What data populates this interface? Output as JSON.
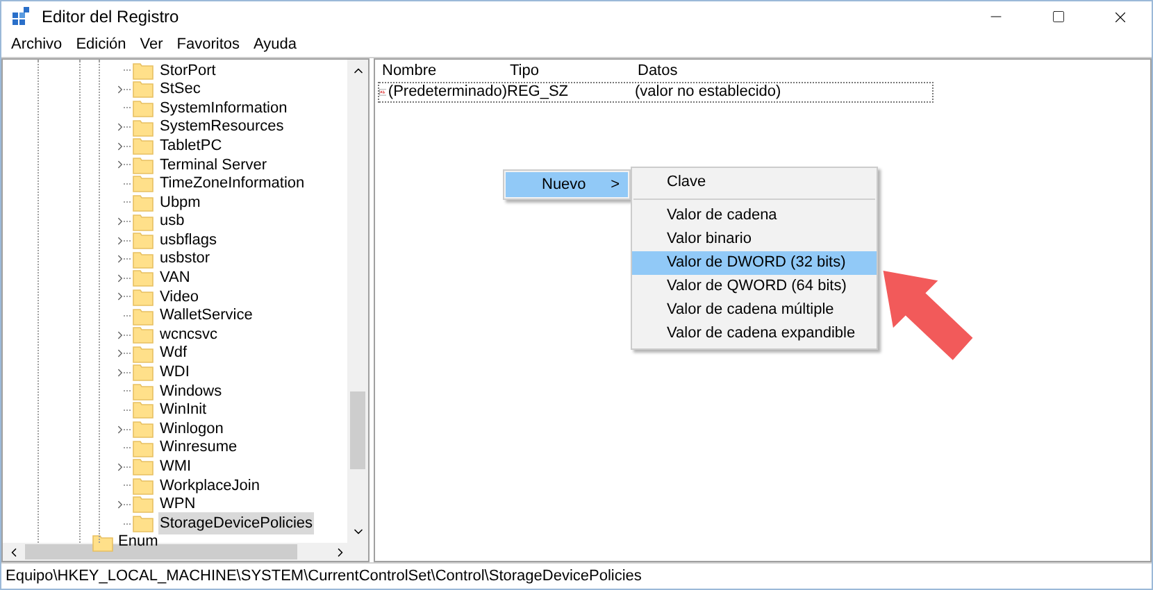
{
  "window": {
    "title": "Editor del Registro"
  },
  "menu_bar": [
    "Archivo",
    "Edición",
    "Ver",
    "Favoritos",
    "Ayuda"
  ],
  "tree": {
    "items": [
      {
        "label": "StorPort",
        "expandable": false,
        "selected": false
      },
      {
        "label": "StSec",
        "expandable": true,
        "selected": false
      },
      {
        "label": "SystemInformation",
        "expandable": false,
        "selected": false
      },
      {
        "label": "SystemResources",
        "expandable": true,
        "selected": false
      },
      {
        "label": "TabletPC",
        "expandable": true,
        "selected": false
      },
      {
        "label": "Terminal Server",
        "expandable": true,
        "selected": false
      },
      {
        "label": "TimeZoneInformation",
        "expandable": false,
        "selected": false
      },
      {
        "label": "Ubpm",
        "expandable": false,
        "selected": false
      },
      {
        "label": "usb",
        "expandable": true,
        "selected": false
      },
      {
        "label": "usbflags",
        "expandable": true,
        "selected": false
      },
      {
        "label": "usbstor",
        "expandable": true,
        "selected": false
      },
      {
        "label": "VAN",
        "expandable": true,
        "selected": false
      },
      {
        "label": "Video",
        "expandable": true,
        "selected": false
      },
      {
        "label": "WalletService",
        "expandable": false,
        "selected": false
      },
      {
        "label": "wcncsvc",
        "expandable": true,
        "selected": false
      },
      {
        "label": "Wdf",
        "expandable": true,
        "selected": false
      },
      {
        "label": "WDI",
        "expandable": true,
        "selected": false
      },
      {
        "label": "Windows",
        "expandable": false,
        "selected": false
      },
      {
        "label": "WinInit",
        "expandable": false,
        "selected": false
      },
      {
        "label": "Winlogon",
        "expandable": true,
        "selected": false
      },
      {
        "label": "Winresume",
        "expandable": false,
        "selected": false
      },
      {
        "label": "WMI",
        "expandable": true,
        "selected": false
      },
      {
        "label": "WorkplaceJoin",
        "expandable": false,
        "selected": false
      },
      {
        "label": "WPN",
        "expandable": true,
        "selected": false
      },
      {
        "label": "StorageDevicePolicies",
        "expandable": false,
        "selected": true
      }
    ],
    "parent_sibling": {
      "label": "Enum"
    }
  },
  "table": {
    "columns": [
      "Nombre",
      "Tipo",
      "Datos"
    ],
    "rows": [
      {
        "name": "(Predeterminado)",
        "type": "REG_SZ",
        "data": "(valor no establecido)"
      }
    ]
  },
  "context_menu": {
    "items": [
      {
        "label": "Nuevo",
        "arrow": ">",
        "selected": true
      }
    ]
  },
  "submenu": {
    "items": [
      {
        "label": "Clave",
        "selected": false,
        "separator_after": true
      },
      {
        "label": "Valor de cadena",
        "selected": false,
        "separator_after": false
      },
      {
        "label": "Valor binario",
        "selected": false,
        "separator_after": false
      },
      {
        "label": "Valor de DWORD (32 bits)",
        "selected": true,
        "separator_after": false
      },
      {
        "label": "Valor de QWORD (64 bits)",
        "selected": false,
        "separator_after": false
      },
      {
        "label": "Valor de cadena múltiple",
        "selected": false,
        "separator_after": false
      },
      {
        "label": "Valor de cadena expandible",
        "selected": false,
        "separator_after": false
      }
    ]
  },
  "status_bar": "Equipo\\HKEY_LOCAL_MACHINE\\SYSTEM\\CurrentControlSet\\Control\\StorageDevicePolicies"
}
